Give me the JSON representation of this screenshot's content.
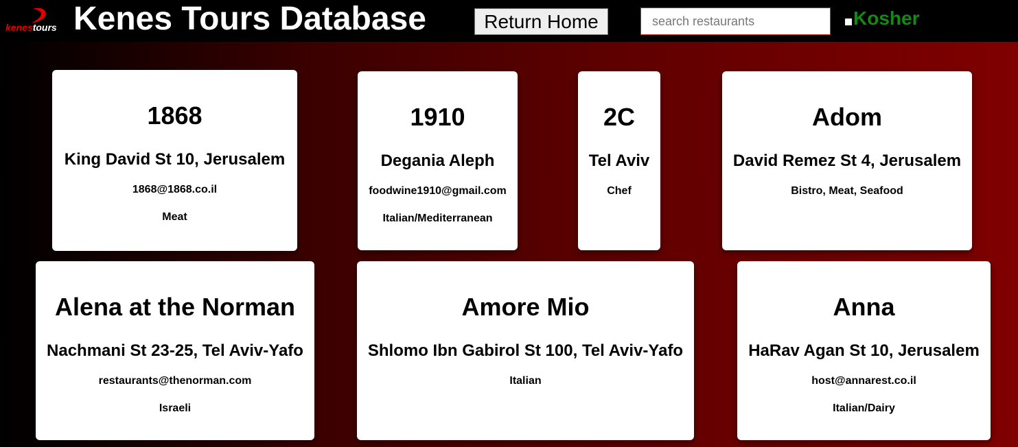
{
  "header": {
    "logo": {
      "text_part1": "kenes",
      "text_part2": "tours",
      "icon": "kenes-swoosh-logo-icon"
    },
    "title": "Kenes Tours Database",
    "home_button_label": "Return Home",
    "search_placeholder": "search restaurants",
    "search_value": "",
    "kosher_label": "Kosher",
    "kosher_checked": false
  },
  "colors": {
    "header_bg": "#000000",
    "gradient_start": "#000000",
    "gradient_end": "#800000",
    "kosher_green": "#138a13",
    "logo_red": "#e00000",
    "search_border": "#c0392b",
    "card_bg": "#ffffff"
  },
  "restaurants": [
    {
      "name": "1868",
      "address": "King David St 10, Jerusalem",
      "line3": "1868@1868.co.il",
      "line4": "Meat"
    },
    {
      "name": "1910",
      "address": "Degania Aleph",
      "line3": "foodwine1910@gmail.com",
      "line4": "Italian/Mediterranean"
    },
    {
      "name": "2C",
      "address": "Tel Aviv",
      "line3": "Chef",
      "line4": ""
    },
    {
      "name": "Adom",
      "address": "David Remez St 4, Jerusalem",
      "line3": "Bistro, Meat, Seafood",
      "line4": ""
    },
    {
      "name": "Alena at the Norman",
      "address": "Nachmani St 23-25, Tel Aviv-Yafo",
      "line3": "restaurants@thenorman.com",
      "line4": "Israeli"
    },
    {
      "name": "Amore Mio",
      "address": "Shlomo Ibn Gabirol St 100, Tel Aviv-Yafo",
      "line3": "Italian",
      "line4": ""
    },
    {
      "name": "Anna",
      "address": "HaRav Agan St 10, Jerusalem",
      "line3": "host@annarest.co.il",
      "line4": "Italian/Dairy"
    }
  ]
}
